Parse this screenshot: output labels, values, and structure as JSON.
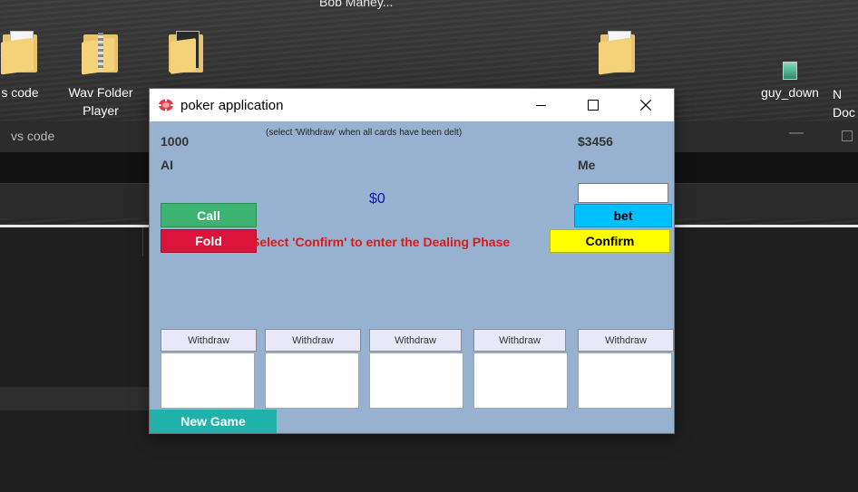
{
  "desktop": {
    "top_label": "Bob Maney...",
    "icons": [
      {
        "label": "s code"
      },
      {
        "label": "Wav Folder Player"
      },
      {
        "label": ""
      },
      {
        "label": ""
      },
      {
        "label": "guy_down"
      },
      {
        "label": "N Doc"
      }
    ]
  },
  "vscode": {
    "title": "vs code"
  },
  "window": {
    "title": "poker application",
    "controls": {
      "minimize": "minimize",
      "maximize": "maximize",
      "close": "close"
    }
  },
  "game": {
    "ai_chips": "1000",
    "ai_label": "AI",
    "player_chips": "$3456",
    "player_label": "Me",
    "hint": "(select 'Withdraw' when all cards have been delt)",
    "pot": "$0",
    "message": "Select 'Confirm' to enter the Dealing Phase",
    "bet_value": ""
  },
  "buttons": {
    "call": "Call",
    "fold": "Fold",
    "bet": "bet",
    "confirm": "Confirm",
    "new_game": "New Game"
  },
  "withdraw_buttons": [
    "Withdraw",
    "Withdraw",
    "Withdraw",
    "Withdraw",
    "Withdraw"
  ],
  "colors": {
    "window_bg": "#97b2d0",
    "call": "#3cb371",
    "fold": "#dc143c",
    "bet": "#00bfff",
    "confirm": "#ffff00",
    "new_game": "#20b2aa",
    "message": "#e01818",
    "pot": "#1010c0"
  }
}
